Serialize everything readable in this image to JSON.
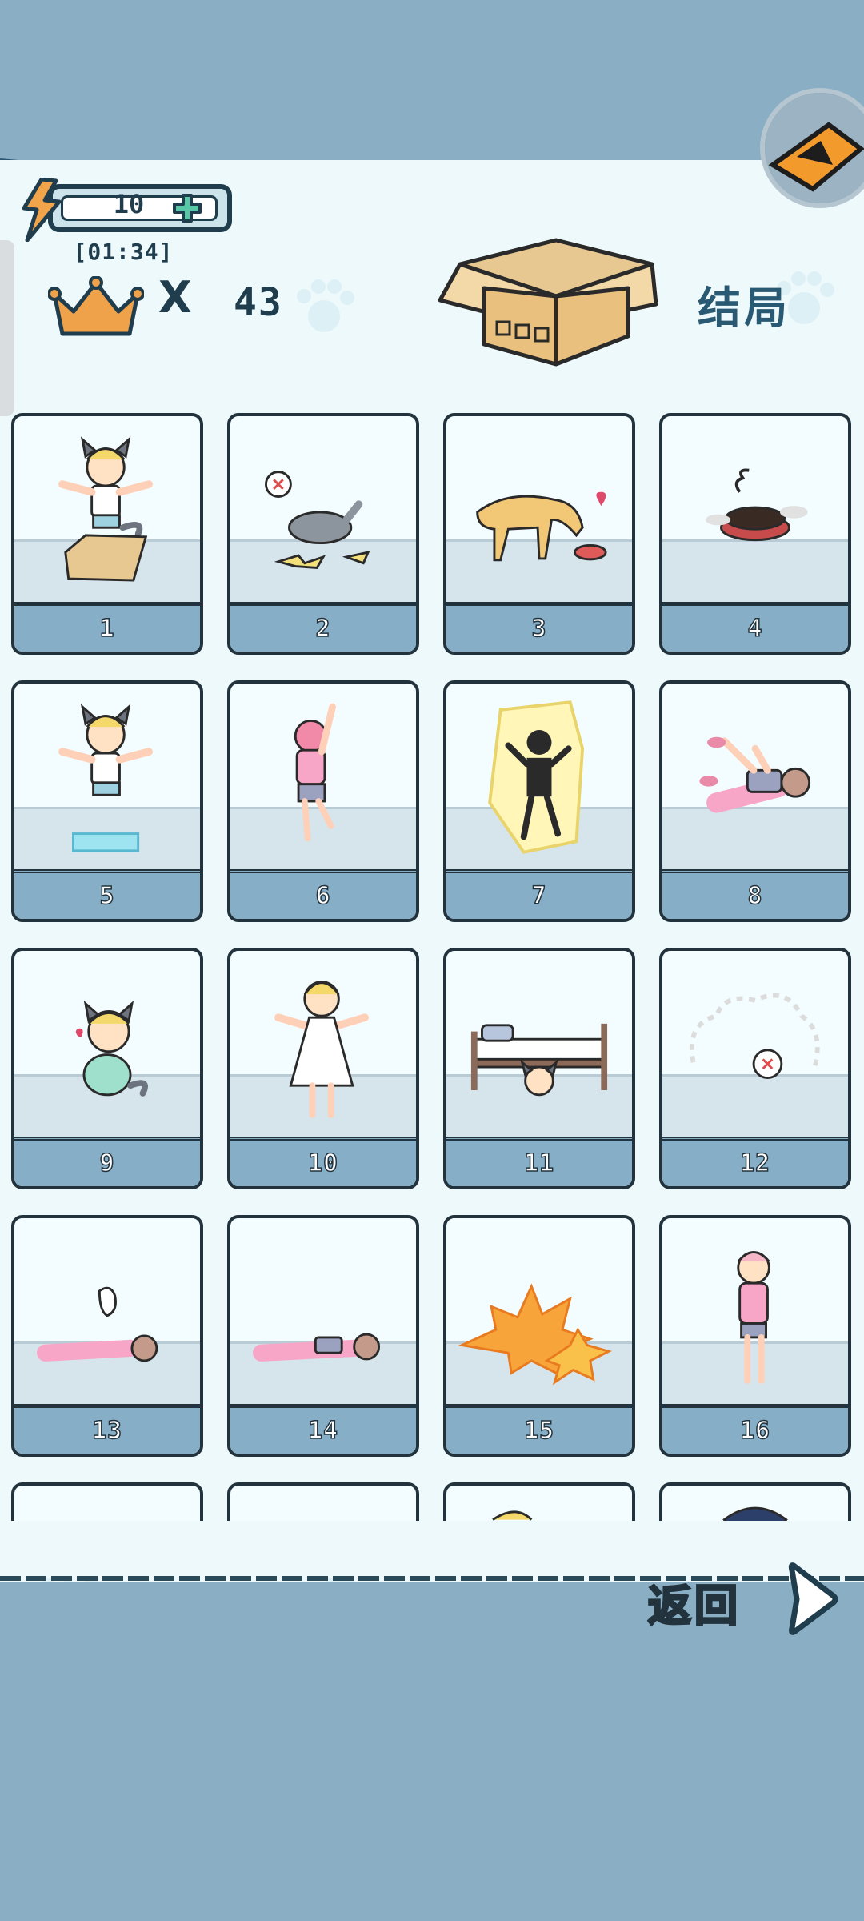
{
  "header": {
    "energy_value": "10",
    "timer": "[01:34]",
    "crown_multiplier": "X",
    "crown_count": "43",
    "title": "结局"
  },
  "endings": [
    {
      "number": "1",
      "scene": "kid-cat-ears-in-box"
    },
    {
      "number": "2",
      "scene": "grumpy-cat-rolling"
    },
    {
      "number": "3",
      "scene": "dog-eating-from-bowl"
    },
    {
      "number": "4",
      "scene": "burnt-cat-food-bowl"
    },
    {
      "number": "5",
      "scene": "kid-cat-ears-frozen"
    },
    {
      "number": "6",
      "scene": "girl-climbing-wall"
    },
    {
      "number": "7",
      "scene": "electrocuted-skeleton"
    },
    {
      "number": "8",
      "scene": "girl-slipping"
    },
    {
      "number": "9",
      "scene": "kid-crouching"
    },
    {
      "number": "10",
      "scene": "kid-in-white-dress"
    },
    {
      "number": "11",
      "scene": "kid-under-bed"
    },
    {
      "number": "12",
      "scene": "angry-dust-cloud"
    },
    {
      "number": "13",
      "scene": "girl-lying-ghost"
    },
    {
      "number": "14",
      "scene": "girl-lying-floor"
    },
    {
      "number": "15",
      "scene": "explosion"
    },
    {
      "number": "16",
      "scene": "girl-standing-confused"
    },
    {
      "number": "",
      "scene": "partial"
    },
    {
      "number": "",
      "scene": "partial"
    },
    {
      "number": "",
      "scene": "partial"
    },
    {
      "number": "",
      "scene": "partial"
    }
  ],
  "footer": {
    "back_label": "返回"
  },
  "colors": {
    "background": "#8aafc4",
    "panel": "#eef9fb",
    "label_bar": "#86aec6",
    "outline": "#22333d",
    "crown": "#f0a24a"
  }
}
